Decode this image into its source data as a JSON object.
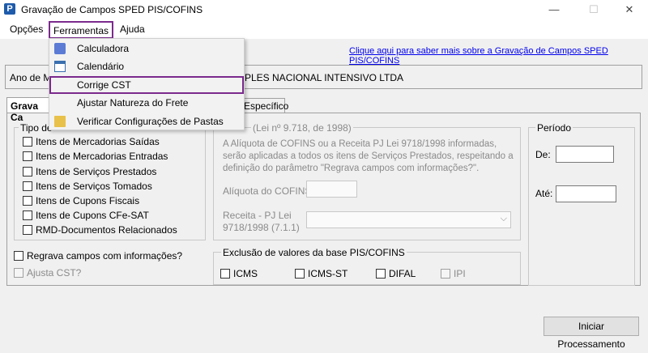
{
  "window": {
    "title": "Gravação de Campos SPED PIS/COFINS",
    "app_icon_letter": "P",
    "minimize": "—",
    "maximize": "☐",
    "close": "✕"
  },
  "menubar": {
    "items": [
      "Opções",
      "Ferramentas",
      "Ajuda"
    ]
  },
  "dropdown": {
    "items": [
      "Calculadora",
      "Calendário",
      "Corrige CST",
      "Ajustar Natureza do Frete",
      "Verificar Configurações de Pastas"
    ],
    "highlighted": "Corrige CST"
  },
  "help_link": "Clique aqui para saber mais sobre a Gravação de Campos SPED PIS/COFINS",
  "header_row": {
    "ano_label": "Ano de Mo",
    "company_visible": "PLES NACIONAL INTENSIVO LTDA"
  },
  "tabs": {
    "tab1": "Grava Ca",
    "tab2": "Específico"
  },
  "tipo_group": {
    "label": "Tipo de",
    "items": [
      "Itens de Mercadorias Saídas",
      "Itens de Mercadorias Entradas",
      "Itens de Serviços Prestados",
      "Itens de Serviços Tomados",
      "Itens de Cupons Fiscais",
      "Itens de Cupons CFe-SAT",
      "RMD-Documentos Relacionados"
    ]
  },
  "regrava": "Regrava campos com informações?",
  "ajusta_cst": "Ajusta CST?",
  "lei_group": {
    "label": "(Lei nº 9.718, de 1998)",
    "description": "A Alíquota de COFINS ou a Receita PJ Lei 9718/1998 informadas, serão aplicadas a todos os itens de Serviços Prestados, respeitando a definição do parâmetro \"Regrava campos com informações?\".",
    "aliquota_label": "Alíquota do COFINS",
    "receita_label_1": "Receita - PJ Lei",
    "receita_label_2": "9718/1998 (7.1.1)"
  },
  "exclusao_group": {
    "label": "Exclusão de valores da base PIS/COFINS",
    "items": [
      "ICMS",
      "ICMS-ST",
      "DIFAL",
      "IPI"
    ]
  },
  "periodo_group": {
    "label": "Período",
    "de_label": "De:",
    "ate_label": "Até:"
  },
  "start_button": "Iniciar Processamento",
  "colors": {
    "highlight_border": "#7b2a8d",
    "link": "#0000ee",
    "background": "#f0f0f0"
  }
}
